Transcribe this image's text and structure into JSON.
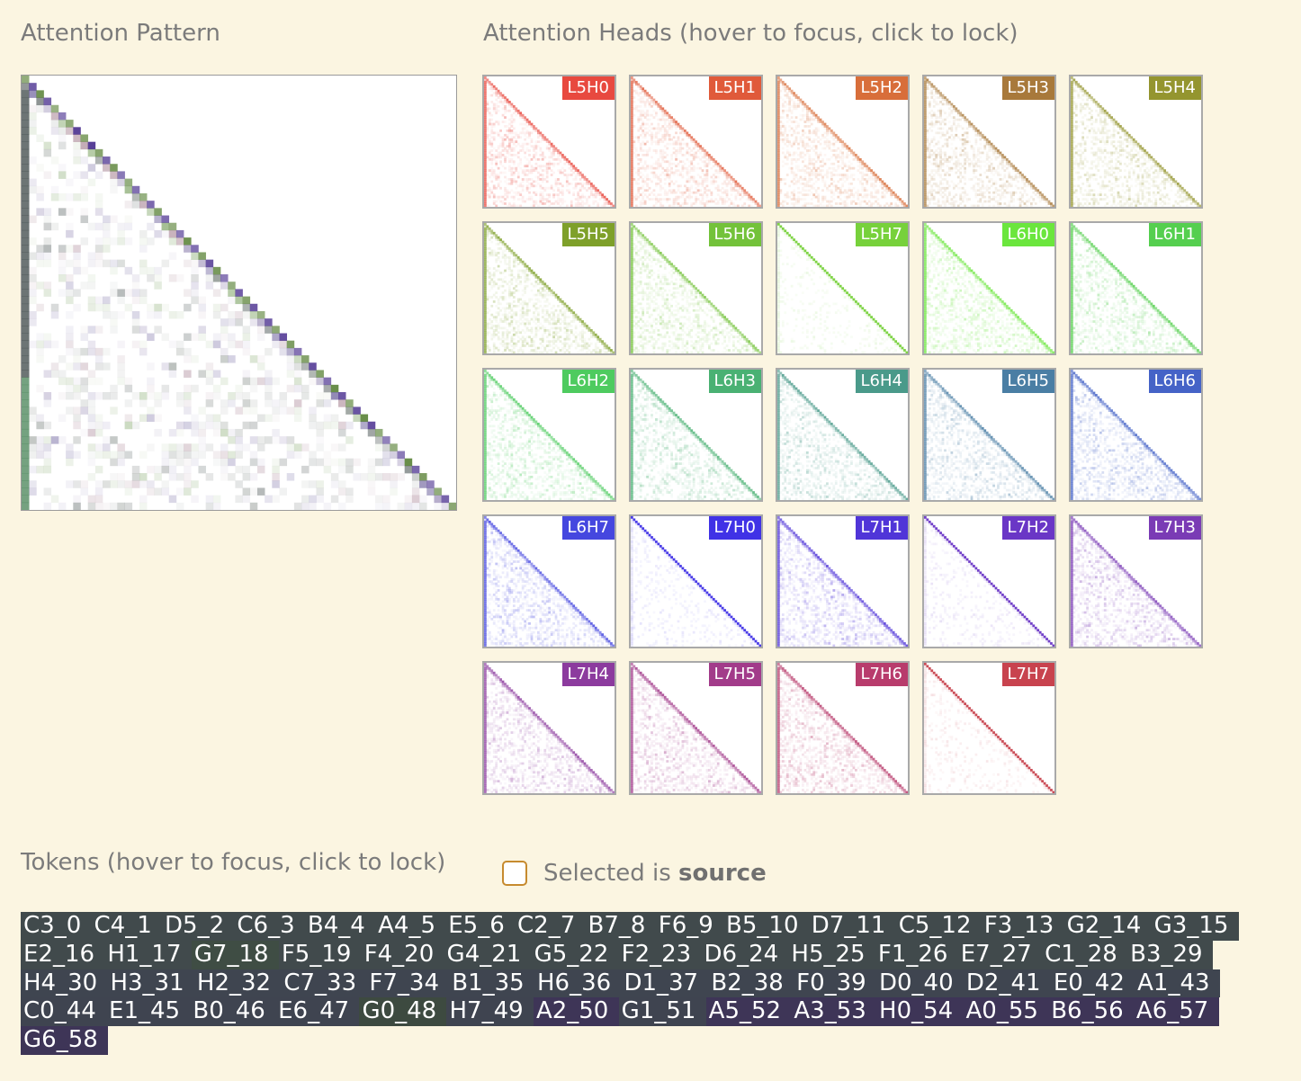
{
  "titles": {
    "attention_pattern": "Attention Pattern",
    "attention_heads": "Attention Heads (hover to focus, click to lock)",
    "tokens": "Tokens (hover to focus, click to lock)"
  },
  "toggle": {
    "prefix": "Selected is ",
    "bold": "source",
    "checked": false
  },
  "heads": [
    {
      "label": "L5H0",
      "color": "#e8493f"
    },
    {
      "label": "L5H1",
      "color": "#e05a3a"
    },
    {
      "label": "L5H2",
      "color": "#d86e3a"
    },
    {
      "label": "L5H3",
      "color": "#a8793b"
    },
    {
      "label": "L5H4",
      "color": "#94952f"
    },
    {
      "label": "L5H5",
      "color": "#7ea02a"
    },
    {
      "label": "L5H6",
      "color": "#73c23a"
    },
    {
      "label": "L5H7",
      "color": "#77d13b"
    },
    {
      "label": "L6H0",
      "color": "#6be63d"
    },
    {
      "label": "L6H1",
      "color": "#55cf4f"
    },
    {
      "label": "L6H2",
      "color": "#4ecb5f"
    },
    {
      "label": "L6H3",
      "color": "#4ab173"
    },
    {
      "label": "L6H4",
      "color": "#4a9a8a"
    },
    {
      "label": "L6H5",
      "color": "#4a7ea4"
    },
    {
      "label": "L6H6",
      "color": "#4563c7"
    },
    {
      "label": "L6H7",
      "color": "#4547df"
    },
    {
      "label": "L7H0",
      "color": "#4032e6"
    },
    {
      "label": "L7H1",
      "color": "#5035d8"
    },
    {
      "label": "L7H2",
      "color": "#6a36c6"
    },
    {
      "label": "L7H3",
      "color": "#7a3bb5"
    },
    {
      "label": "L7H4",
      "color": "#8c3b9e"
    },
    {
      "label": "L7H5",
      "color": "#a23b8a"
    },
    {
      "label": "L7H6",
      "color": "#b83c6c"
    },
    {
      "label": "L7H7",
      "color": "#c8434e"
    }
  ],
  "tokens": [
    {
      "text": "C3_0 ",
      "color": "#414a4c"
    },
    {
      "text": "C4_1 ",
      "color": "#414a4c"
    },
    {
      "text": "D5_2 ",
      "color": "#414a4c"
    },
    {
      "text": "C6_3 ",
      "color": "#414a4c"
    },
    {
      "text": "B4_4 ",
      "color": "#414a4c"
    },
    {
      "text": "A4_5 ",
      "color": "#414a4c"
    },
    {
      "text": "E5_6 ",
      "color": "#414a4c"
    },
    {
      "text": "C2_7 ",
      "color": "#414a4c"
    },
    {
      "text": "B7_8 ",
      "color": "#414a4c"
    },
    {
      "text": "F6_9 ",
      "color": "#414a4c"
    },
    {
      "text": "B5_10 ",
      "color": "#414a4c"
    },
    {
      "text": "D7_11 ",
      "color": "#414a4c"
    },
    {
      "text": "C5_12 ",
      "color": "#414a4c"
    },
    {
      "text": "F3_13 ",
      "color": "#414a4c"
    },
    {
      "text": "G2_14 ",
      "color": "#414a4c"
    },
    {
      "text": "G3_15 ",
      "color": "#414a4c"
    },
    {
      "text": "E2_16 ",
      "color": "#414a4c"
    },
    {
      "text": "H1_17 ",
      "color": "#414a4c"
    },
    {
      "text": "G7_18 ",
      "color": "#3f4d44"
    },
    {
      "text": "F5_19 ",
      "color": "#414a4c"
    },
    {
      "text": "F4_20 ",
      "color": "#414a4c"
    },
    {
      "text": "G4_21 ",
      "color": "#414a4c"
    },
    {
      "text": "G5_22 ",
      "color": "#414a4c"
    },
    {
      "text": "F2_23 ",
      "color": "#414a4c"
    },
    {
      "text": "D6_24 ",
      "color": "#414a4c"
    },
    {
      "text": "H5_25 ",
      "color": "#414a4c"
    },
    {
      "text": "F1_26 ",
      "color": "#414a4c"
    },
    {
      "text": "E7_27 ",
      "color": "#414a4c"
    },
    {
      "text": "C1_28 ",
      "color": "#414a4c"
    },
    {
      "text": "B3_29 ",
      "color": "#414a4c"
    },
    {
      "text": "H4_30 ",
      "color": "#3f4550"
    },
    {
      "text": "H3_31 ",
      "color": "#3f4550"
    },
    {
      "text": "H2_32 ",
      "color": "#3f4550"
    },
    {
      "text": "C7_33 ",
      "color": "#3f4550"
    },
    {
      "text": "F7_34 ",
      "color": "#3f4550"
    },
    {
      "text": "B1_35 ",
      "color": "#3f4550"
    },
    {
      "text": "H6_36 ",
      "color": "#3f4550"
    },
    {
      "text": "D1_37 ",
      "color": "#3f4550"
    },
    {
      "text": "B2_38 ",
      "color": "#3f4550"
    },
    {
      "text": "F0_39 ",
      "color": "#3f4550"
    },
    {
      "text": "D0_40 ",
      "color": "#3f4550"
    },
    {
      "text": "D2_41 ",
      "color": "#3f4550"
    },
    {
      "text": "E0_42 ",
      "color": "#3f4550"
    },
    {
      "text": "A1_43 ",
      "color": "#3f4550"
    },
    {
      "text": "C0_44 ",
      "color": "#3f4450"
    },
    {
      "text": "E1_45 ",
      "color": "#3f4450"
    },
    {
      "text": "B0_46 ",
      "color": "#3f4450"
    },
    {
      "text": "E6_47 ",
      "color": "#3f4450"
    },
    {
      "text": "G0_48 ",
      "color": "#3d4a40"
    },
    {
      "text": "H7_49 ",
      "color": "#3f4450"
    },
    {
      "text": "A2_50 ",
      "color": "#3e3557"
    },
    {
      "text": "G1_51 ",
      "color": "#3f4450"
    },
    {
      "text": "A5_52 ",
      "color": "#3e3557"
    },
    {
      "text": "A3_53 ",
      "color": "#3e3557"
    },
    {
      "text": "H0_54 ",
      "color": "#3e3557"
    },
    {
      "text": "A0_55 ",
      "color": "#3e3557"
    },
    {
      "text": "B6_56 ",
      "color": "#3e3557"
    },
    {
      "text": "A6_57 ",
      "color": "#3e3557"
    },
    {
      "text": "G6_58 ",
      "color": "#3e3557"
    }
  ]
}
